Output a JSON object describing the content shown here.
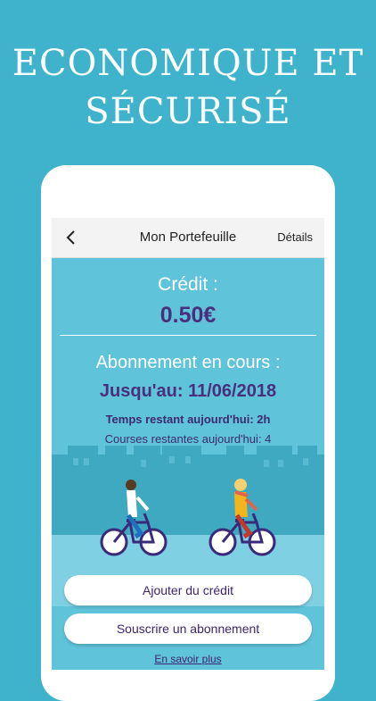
{
  "headline": {
    "line1": "ECONOMIQUE ET",
    "line2": "SÉCURISÉ"
  },
  "appbar": {
    "title": "Mon Portefeuille",
    "details": "Détails"
  },
  "wallet": {
    "credit_label": "Crédit :",
    "credit_value": "0.50€",
    "subscription_label": "Abonnement en cours :",
    "subscription_until": "Jusqu'au: 11/06/2018",
    "time_left": "Temps restant aujourd'hui: 2h",
    "rides_left": "Courses restantes aujourd'hui: 4"
  },
  "actions": {
    "add_credit": "Ajouter du crédit",
    "subscribe": "Souscrire un abonnement",
    "learn_more": "En savoir plus"
  },
  "colors": {
    "background": "#3eb3cb",
    "screen": "#5fc3d9",
    "accent_purple": "#4a2f7e",
    "city_silhouette": "#3aa6bf",
    "bike_frame": "#3a2a7a"
  }
}
